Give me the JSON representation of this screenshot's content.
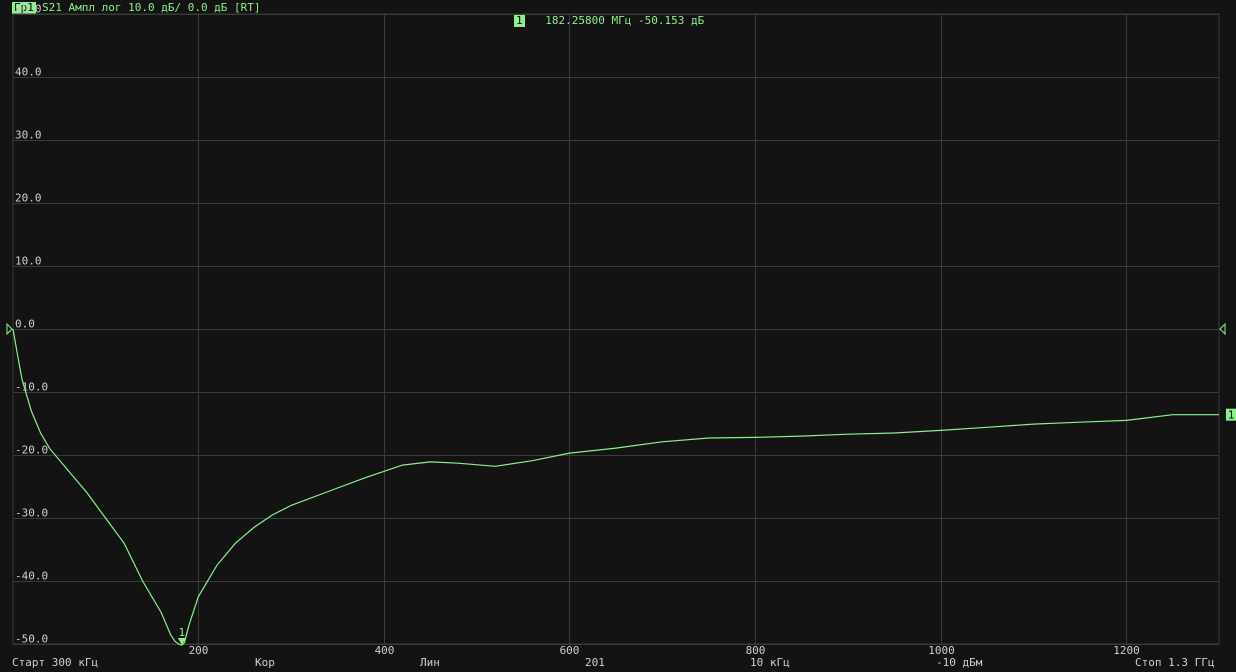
{
  "header": {
    "trace_tag": "Гр1",
    "title": "S21 Ампл лог 10.0 дБ/ 0.0 дБ [RT]"
  },
  "marker_readout": {
    "tag": "1",
    "text": "182.25800 МГц -50.153 дБ"
  },
  "footer": {
    "start": "Старт 300 кГц",
    "format": "Кор",
    "sweep": "Лин",
    "points": "201",
    "ifbw": "10 кГц",
    "power": "-10 дБм",
    "stop": "Стоп 1.3 ГГц"
  },
  "colors": {
    "background": "#131313",
    "grid": "#3a3a3a",
    "trace": "#8cf08c",
    "text": "#cfcfcf"
  },
  "chart_data": {
    "type": "line",
    "title": "S21 Ампл лог 10.0 дБ/ 0.0 дБ [RT]",
    "xlabel": "",
    "ylabel": "",
    "xlim": [
      0.3,
      1300
    ],
    "ylim": [
      -50,
      50
    ],
    "x_ticks": [
      200,
      400,
      600,
      800,
      1000,
      1200
    ],
    "x_tick_labels": [
      "200",
      "400",
      "600",
      "800",
      "1000",
      "1200"
    ],
    "y_ticks": [
      50,
      40,
      30,
      20,
      10,
      0,
      -10,
      -20,
      -30,
      -40,
      -50
    ],
    "y_tick_labels": [
      "50.0",
      "40.0",
      "30.0",
      "20.0",
      "10.0",
      "0.0",
      "-10.0",
      "-20.0",
      "-30.0",
      "-40.0",
      "-50.0"
    ],
    "grid": true,
    "reference_level": 0,
    "series": [
      {
        "name": "S21",
        "x": [
          0.3,
          5,
          10,
          20,
          30,
          40,
          60,
          80,
          100,
          120,
          140,
          160,
          170,
          175,
          180,
          182.258,
          185,
          190,
          200,
          220,
          240,
          260,
          280,
          300,
          340,
          380,
          420,
          450,
          480,
          520,
          560,
          600,
          650,
          700,
          750,
          800,
          850,
          900,
          950,
          1000,
          1050,
          1100,
          1150,
          1200,
          1250,
          1300
        ],
        "y": [
          0,
          -4,
          -8,
          -13,
          -16.5,
          -19,
          -22.5,
          -26,
          -30,
          -34,
          -40,
          -45,
          -48.5,
          -49.6,
          -50.1,
          -50.153,
          -49.8,
          -47,
          -42.5,
          -37.5,
          -34,
          -31.5,
          -29.5,
          -28,
          -25.8,
          -23.6,
          -21.6,
          -21.1,
          -21.3,
          -21.8,
          -20.9,
          -19.7,
          -18.9,
          -17.9,
          -17.3,
          -17.2,
          -17.0,
          -16.7,
          -16.5,
          -16.1,
          -15.6,
          -15.1,
          -14.8,
          -14.5,
          -13.6,
          -13.6
        ]
      }
    ],
    "markers": [
      {
        "label": "1",
        "x": 182.258,
        "y": -50.153
      }
    ],
    "trace_end_label": "1"
  }
}
